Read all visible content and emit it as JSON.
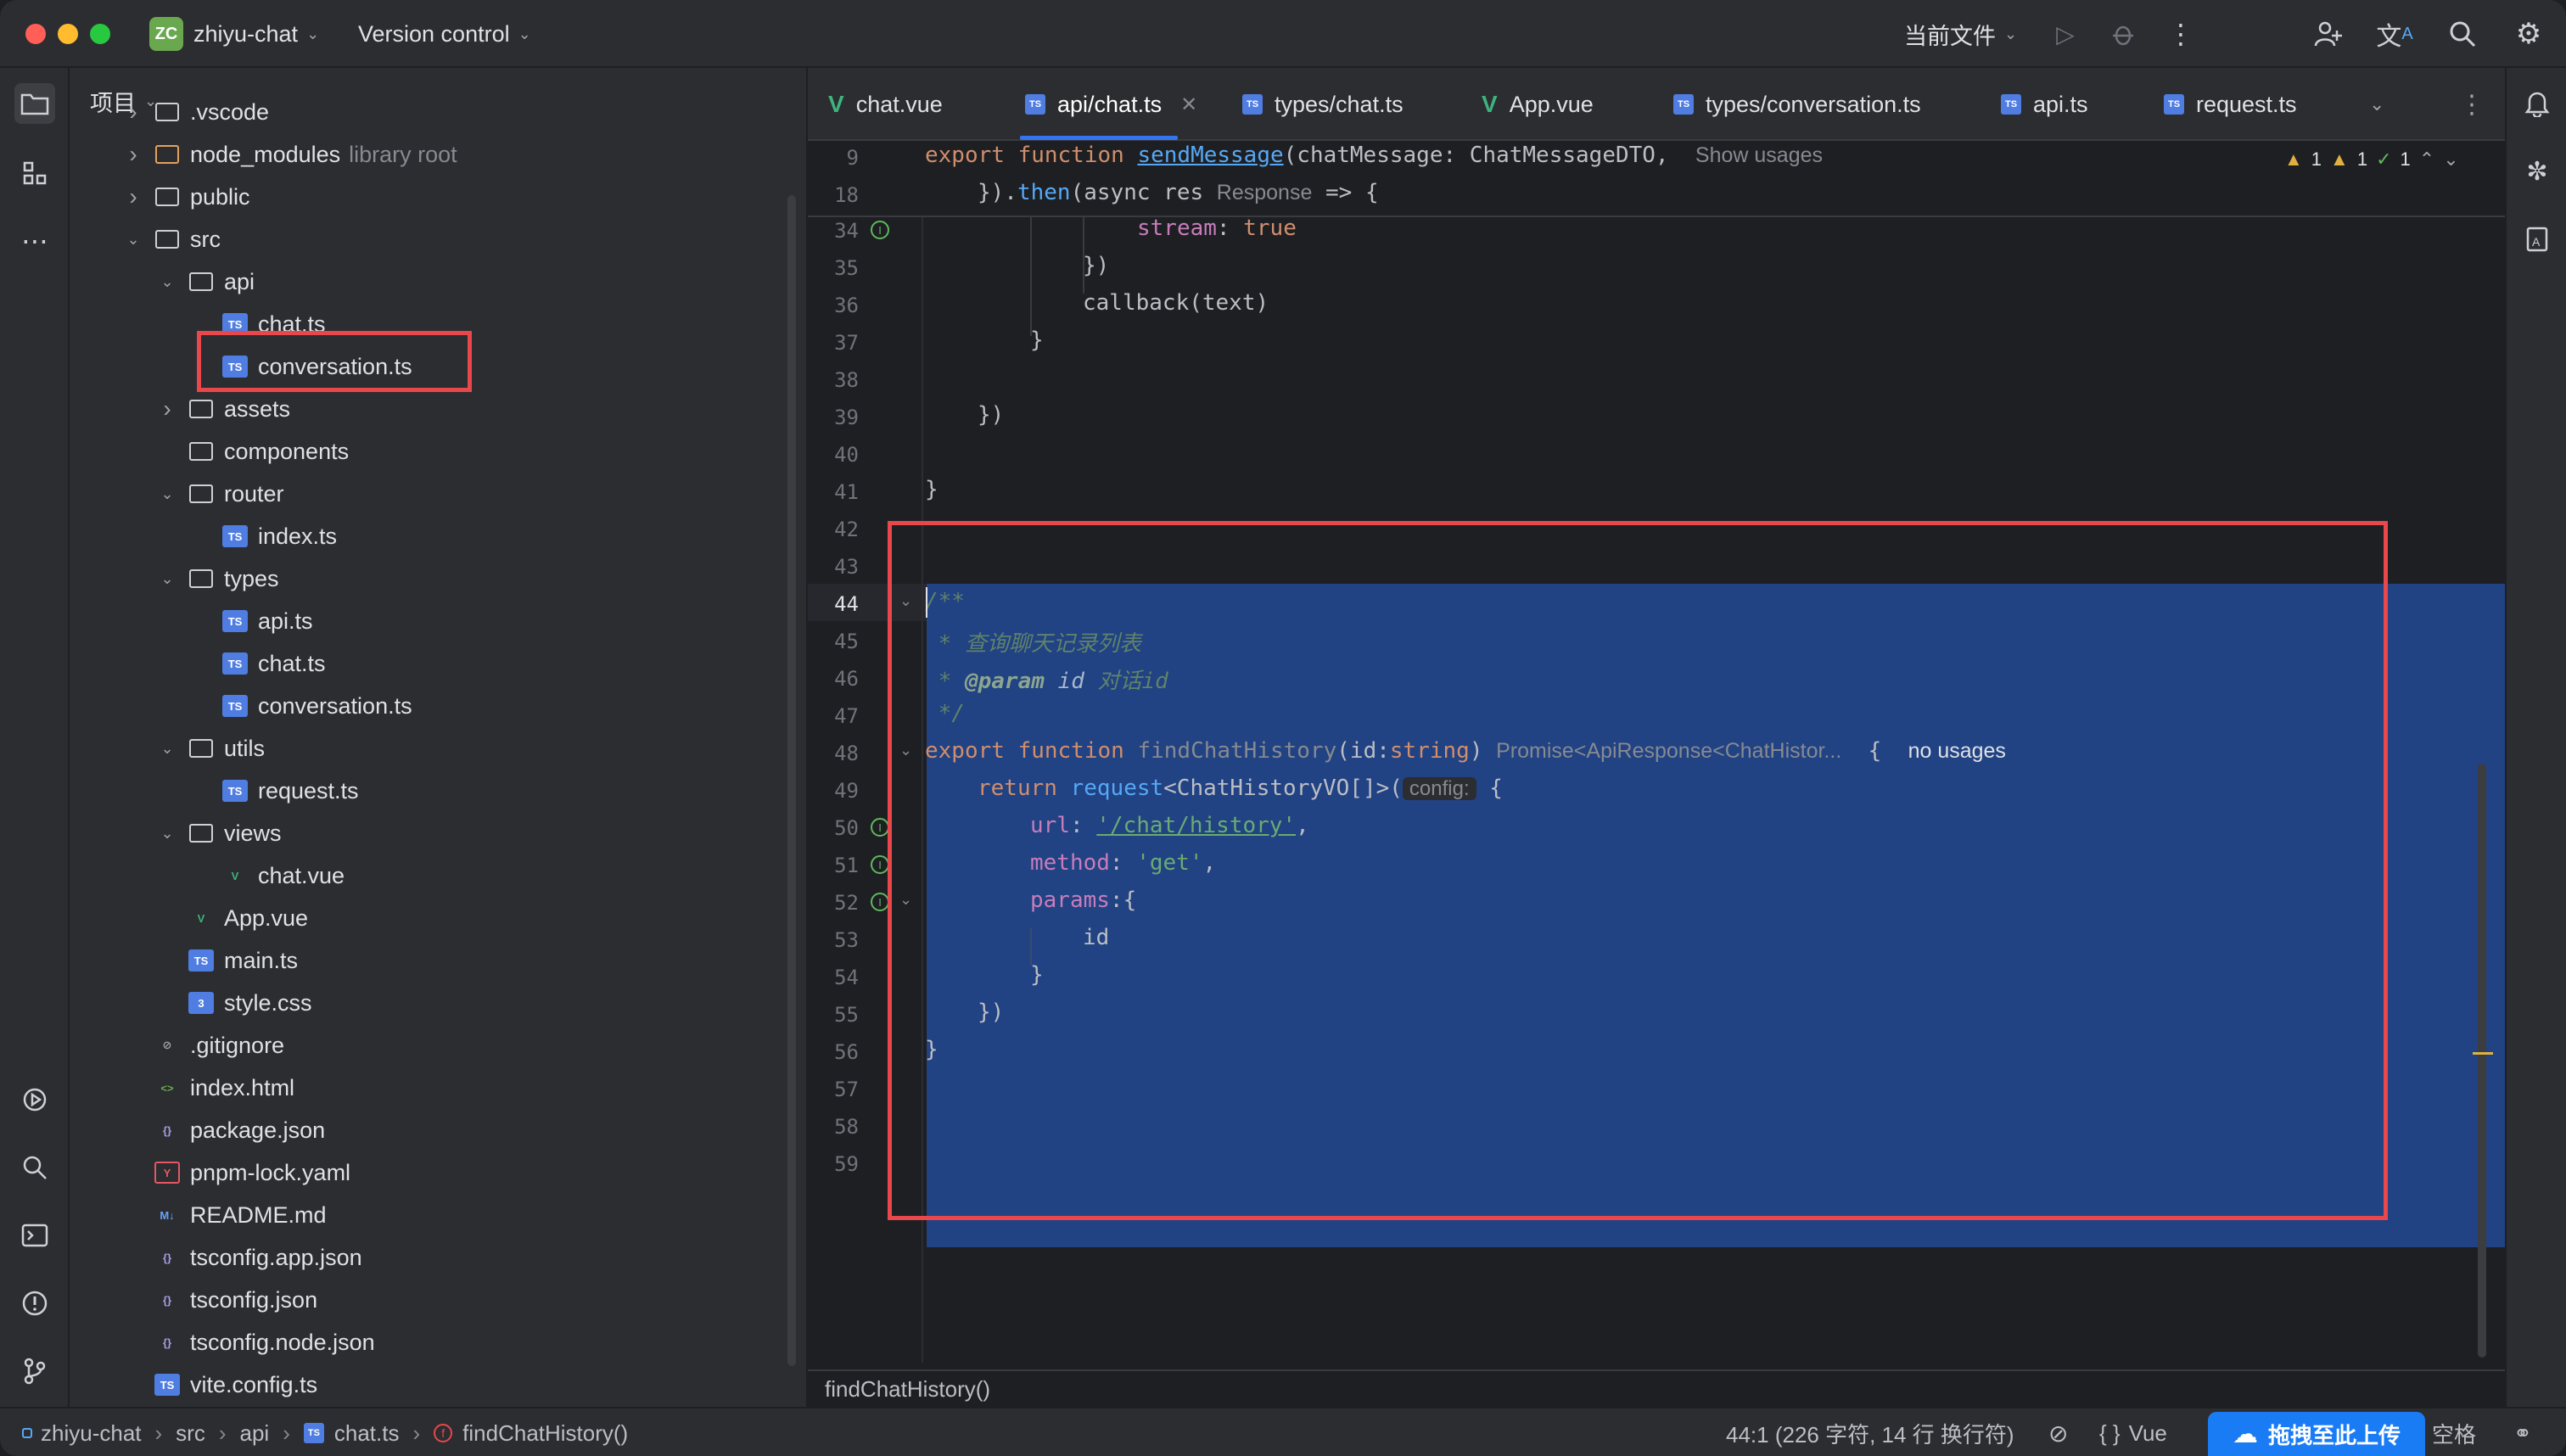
{
  "titlebar": {
    "project_badge": "ZC",
    "project_name": "zhiyu-chat",
    "vcs_label": "Version control",
    "run_config": "当前文件",
    "icons": [
      "run-icon",
      "debug-icon",
      "more-icon",
      "add-user-icon",
      "translate-icon",
      "search-icon",
      "settings-icon"
    ]
  },
  "project_panel": {
    "title": "项目",
    "rows": [
      {
        "label": ".vscode",
        "type": "folder",
        "expanded": false
      },
      {
        "label": "node_modules",
        "type": "folder-orange",
        "suffix": "library root",
        "expanded": false
      },
      {
        "label": "public",
        "type": "folder",
        "expanded": false
      },
      {
        "label": "src",
        "type": "folder",
        "expanded": true
      },
      {
        "label": "api",
        "type": "folder",
        "expanded": true
      },
      {
        "label": "chat.ts",
        "type": "ts",
        "selected": true
      },
      {
        "label": "conversation.ts",
        "type": "ts"
      },
      {
        "label": "assets",
        "type": "folder",
        "expanded": false
      },
      {
        "label": "components",
        "type": "folder"
      },
      {
        "label": "router",
        "type": "folder",
        "expanded": true
      },
      {
        "label": "index.ts",
        "type": "ts"
      },
      {
        "label": "types",
        "type": "folder",
        "expanded": true
      },
      {
        "label": "api.ts",
        "type": "ts"
      },
      {
        "label": "chat.ts",
        "type": "ts"
      },
      {
        "label": "conversation.ts",
        "type": "ts"
      },
      {
        "label": "utils",
        "type": "folder",
        "expanded": true
      },
      {
        "label": "request.ts",
        "type": "ts"
      },
      {
        "label": "views",
        "type": "folder",
        "expanded": true
      },
      {
        "label": "chat.vue",
        "type": "vue"
      },
      {
        "label": "App.vue",
        "type": "vue"
      },
      {
        "label": "main.ts",
        "type": "ts"
      },
      {
        "label": "style.css",
        "type": "css"
      },
      {
        "label": ".gitignore",
        "type": "gitignore"
      },
      {
        "label": "index.html",
        "type": "html"
      },
      {
        "label": "package.json",
        "type": "json"
      },
      {
        "label": "pnpm-lock.yaml",
        "type": "yaml"
      },
      {
        "label": "README.md",
        "type": "md"
      },
      {
        "label": "tsconfig.app.json",
        "type": "json"
      },
      {
        "label": "tsconfig.json",
        "type": "json"
      },
      {
        "label": "tsconfig.node.json",
        "type": "json"
      },
      {
        "label": "vite.config.ts",
        "type": "ts"
      }
    ]
  },
  "tabs": [
    {
      "label": "chat.vue",
      "type": "vue"
    },
    {
      "label": "api/chat.ts",
      "type": "ts",
      "active": true
    },
    {
      "label": "types/chat.ts",
      "type": "ts"
    },
    {
      "label": "App.vue",
      "type": "vue"
    },
    {
      "label": "types/conversation.ts",
      "type": "ts"
    },
    {
      "label": "api.ts",
      "type": "ts"
    },
    {
      "label": "request.ts",
      "type": "ts"
    }
  ],
  "inspections": {
    "warn1": "1",
    "warn2": "1",
    "ok": "1"
  },
  "editor": {
    "sticky": [
      {
        "ln": "9",
        "t1": "export function ",
        "t2": "sendMessage",
        "t3": "(chatMessage: ChatMessageDTO,",
        "hint": "Show usages"
      },
      {
        "ln": "18",
        "t1": "}).",
        "t2": "then",
        "t3": "(async res ",
        "hint": "Response",
        "t4": " => {"
      }
    ],
    "lines": {
      "l34": {
        "ln": "34",
        "prop": "stream",
        "rest": ": ",
        "kw": "true"
      },
      "l35": {
        "ln": "35",
        "text": "})"
      },
      "l36": {
        "ln": "36",
        "text": "callback(text)"
      },
      "l37": {
        "ln": "37",
        "text": "}"
      },
      "l38": {
        "ln": "38"
      },
      "l39": {
        "ln": "39",
        "text": "})"
      },
      "l40": {
        "ln": "40"
      },
      "l41": {
        "ln": "41",
        "text": "}"
      },
      "l42": {
        "ln": "42"
      },
      "l43": {
        "ln": "43"
      },
      "l44": {
        "ln": "44",
        "text": "/**"
      },
      "l45": {
        "ln": "45",
        "text": " * 查询聊天记录列表"
      },
      "l46": {
        "ln": "46",
        "t1": " * ",
        "t2": "@param",
        "t3": " id",
        "t4": " 对话id"
      },
      "l47": {
        "ln": "47",
        "text": " */"
      },
      "l48": {
        "ln": "48",
        "kw": "export function ",
        "fn": "findChatHistory",
        "rest": "(id:",
        "kw2": "string",
        "rest2": ")",
        "hint": "Promise<ApiResponse<ChatHistor...",
        "brace": "{",
        "usages": "no usages"
      },
      "l49": {
        "ln": "49",
        "kw": "return ",
        "fn": "request",
        "rest": "<ChatHistoryVO[]>(",
        "hint": "config:",
        "brace": " {"
      },
      "l50": {
        "ln": "50",
        "prop": "url",
        "rest": ": ",
        "str": "'/chat/history'",
        "tail": ","
      },
      "l51": {
        "ln": "51",
        "prop": "method",
        "rest": ": ",
        "str": "'get'",
        "tail": ","
      },
      "l52": {
        "ln": "52",
        "prop": "params",
        "rest": ":{"
      },
      "l53": {
        "ln": "53",
        "text": "id"
      },
      "l54": {
        "ln": "54",
        "text": "}"
      },
      "l55": {
        "ln": "55",
        "text": "})"
      },
      "l56": {
        "ln": "56",
        "text": "}"
      },
      "l57": {
        "ln": "57"
      },
      "l58": {
        "ln": "58"
      },
      "l59": {
        "ln": "59"
      }
    },
    "breadcrumb": "findChatHistory()"
  },
  "statusbar": {
    "path": [
      "zhiyu-chat",
      "src",
      "api",
      "chat.ts",
      "findChatHistory()"
    ],
    "position": "44:1 (226 字符, 14 行 换行符)",
    "lang": "Vue",
    "indent": "空格",
    "upload_label": "拖拽至此上传"
  },
  "colors": {
    "accent": "#3574f0",
    "selection": "#214283",
    "highlight_box": "#e8474c"
  }
}
